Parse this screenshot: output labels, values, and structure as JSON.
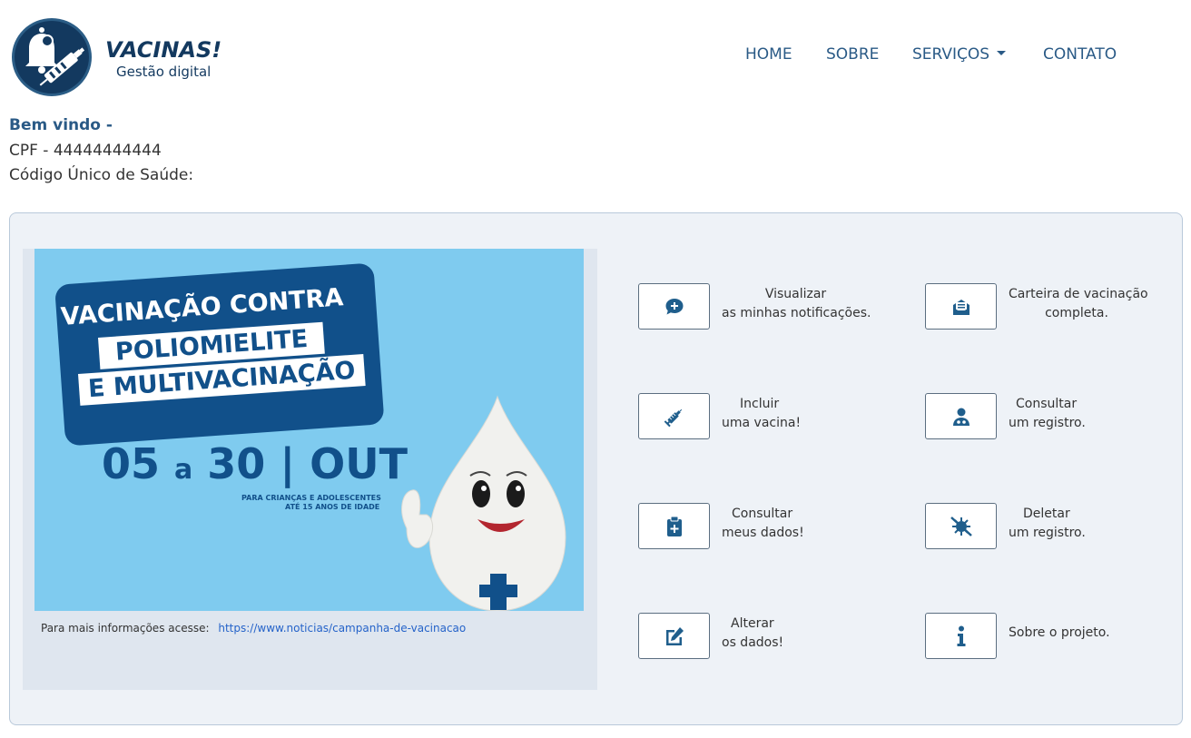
{
  "brand": {
    "title": "VACINAS!",
    "subtitle": "Gestão digital"
  },
  "nav": {
    "home": "HOME",
    "sobre": "SOBRE",
    "servicos": "SERVIÇOS",
    "contato": "CONTATO"
  },
  "user": {
    "welcome": "Bem vindo -",
    "cpf": "CPF - 44444444444",
    "sus_code": "Código Único de Saúde:"
  },
  "banner": {
    "line1": "VACINAÇÃO CONTRA",
    "line2": "POLIOMIELITE",
    "line3": "E MULTIVACINAÇÃO",
    "date_start": "05",
    "date_mid": "a",
    "date_end": "30",
    "date_sep": "|",
    "month": "OUT",
    "note1": "PARA CRIANÇAS E ADOLESCENTES",
    "note2": "ATÉ 15 ANOS DE IDADE"
  },
  "info": {
    "label": "Para mais informações acesse:",
    "link": "https://www.noticias/campanha-de-vacinacao"
  },
  "actions": {
    "notifications": {
      "line1": "Visualizar",
      "line2": "as minhas notificações.",
      "icon": "comment-plus-icon"
    },
    "card": {
      "line1": "Carteira de vacinação",
      "line2": "completa.",
      "icon": "envelope-open-text-icon"
    },
    "add_vaccine": {
      "line1": "Incluir",
      "line2": "uma vacina!",
      "icon": "syringe-icon"
    },
    "consult_record": {
      "line1": "Consultar",
      "line2": "um registro.",
      "icon": "user-doctor-icon"
    },
    "my_data": {
      "line1": "Consultar",
      "line2": "meus dados!",
      "icon": "clipboard-plus-icon"
    },
    "delete_record": {
      "line1": "Deletar",
      "line2": "um registro.",
      "icon": "virus-slash-icon"
    },
    "edit_data": {
      "line1": "Alterar",
      "line2": "os dados!",
      "icon": "pen-to-square-icon"
    },
    "about": {
      "line1": "Sobre o projeto.",
      "line2": "",
      "icon": "info-icon"
    }
  },
  "colors": {
    "brand": "#13395f",
    "nav": "#2a5a86",
    "panel_bg": "#eef2f7",
    "banner_bg": "#7fcbef",
    "banner_blue": "#11508a",
    "link": "#2563c9"
  }
}
